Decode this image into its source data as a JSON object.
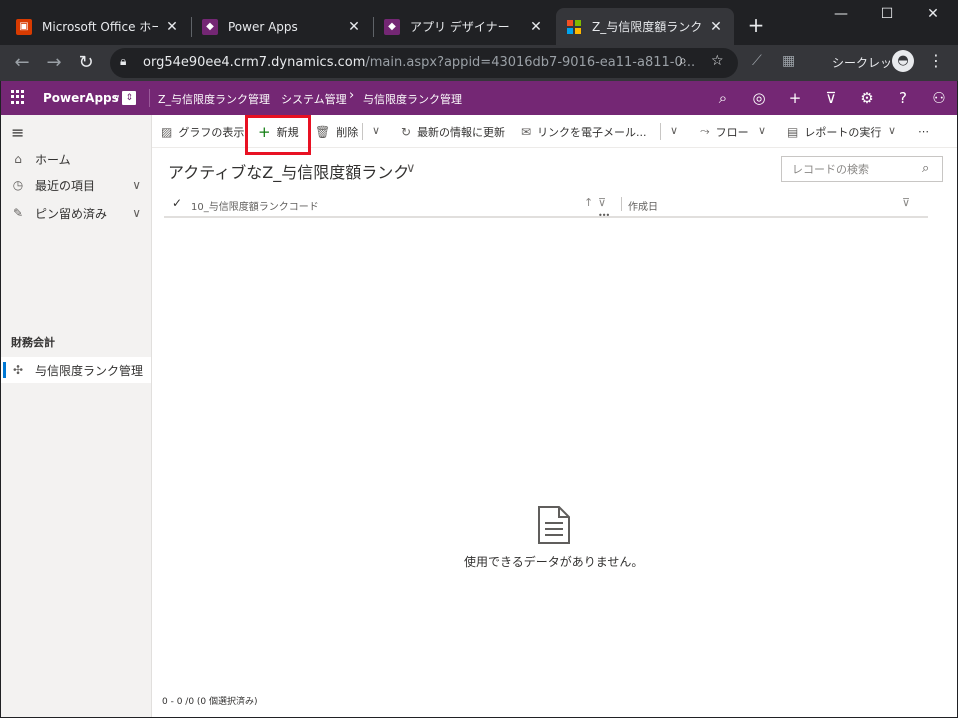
{
  "browser": {
    "tabs": [
      {
        "title": "Microsoft Office ホーム",
        "icon": "office-icon",
        "active": false
      },
      {
        "title": "Power Apps",
        "icon": "powerapps-icon",
        "active": false
      },
      {
        "title": "アプリ デザイナー",
        "icon": "powerapps-icon",
        "active": false
      },
      {
        "title": "Z_与信限度額ランク ア",
        "icon": "microsoft-icon",
        "active": true
      }
    ],
    "new_tab_label": "+",
    "url_host": "org54e90ee4.crm7.dynamics.com",
    "url_path": "/main.aspx?appid=43016db7-9016-ea11-a811-0...",
    "incognito_label": "シークレット"
  },
  "appbar": {
    "app_name": "PowerApps",
    "breadcrumb": {
      "app": "Z_与信限度ランク管理",
      "area": "システム管理",
      "page": "与信限度ランク管理"
    }
  },
  "sidenav": {
    "items": [
      {
        "label": "ホーム",
        "icon": "home-icon"
      },
      {
        "label": "最近の項目",
        "icon": "clock-icon"
      },
      {
        "label": "ピン留め済み",
        "icon": "pin-icon"
      }
    ],
    "group_label": "財務会計",
    "entity_item": {
      "label": "与信限度ランク管理",
      "icon": "puzzle-icon"
    }
  },
  "commandbar": {
    "show_chart": "グラフの表示",
    "new": "新規",
    "delete": "削除",
    "refresh": "最新の情報に更新",
    "email_link": "リンクを電子メール...",
    "flow": "フロー",
    "run_report": "レポートの実行",
    "more": "⋯"
  },
  "view": {
    "title": "アクティブなZ_与信限度額ランク",
    "search_placeholder": "レコードの検索"
  },
  "grid": {
    "columns": [
      "10_与信限度額ランクコード",
      "作成日"
    ],
    "empty_message": "使用できるデータがありません。",
    "footer": "0 - 0 /0 (0 個選択済み)"
  },
  "colors": {
    "appbar": "#742774",
    "highlight": "#e81123",
    "selection_bar": "#0078d4"
  }
}
